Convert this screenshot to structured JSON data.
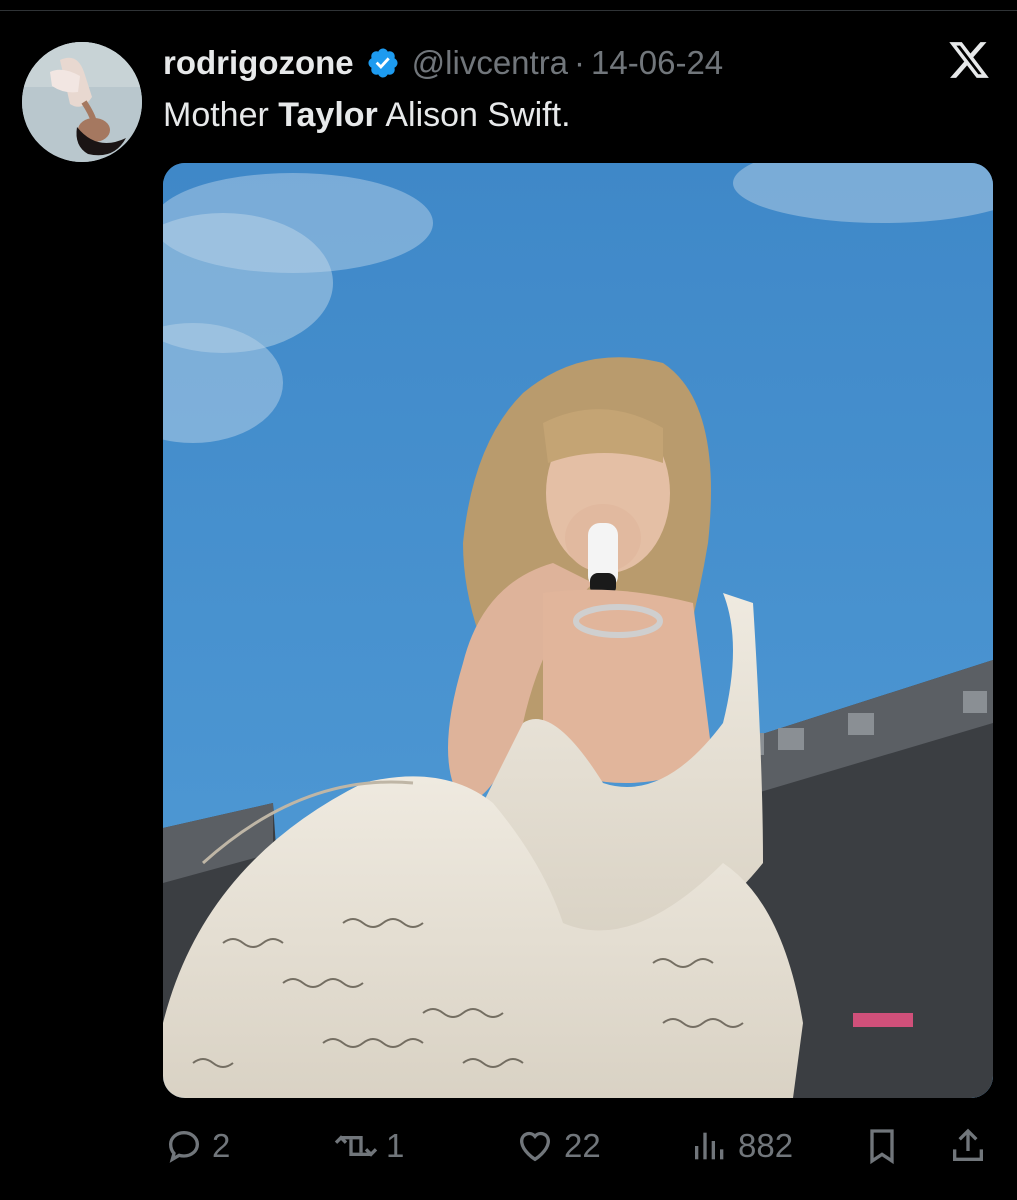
{
  "tweet": {
    "display_name": "rodrigozone",
    "handle": "@livcentra",
    "separator": "·",
    "date": "14-06-24",
    "text_before": "Mother ",
    "text_bold": "Taylor",
    "text_after": " Alison Swift."
  },
  "media": {
    "subject": "performer in white corset gown with handwritten lyrics, singing into microphone under blue sky with stadium roof"
  },
  "actions": {
    "reply_count": "2",
    "repost_count": "1",
    "like_count": "22",
    "view_count": "882"
  },
  "icons": [
    "avatar",
    "verified-badge-icon",
    "x-logo-icon",
    "reply-icon",
    "repost-icon",
    "like-icon",
    "views-icon",
    "bookmark-icon",
    "share-icon"
  ],
  "colors": {
    "background": "#000000",
    "primary_text": "#e7e9ea",
    "secondary_text": "#71767b",
    "verified": "#1d9bf0"
  }
}
